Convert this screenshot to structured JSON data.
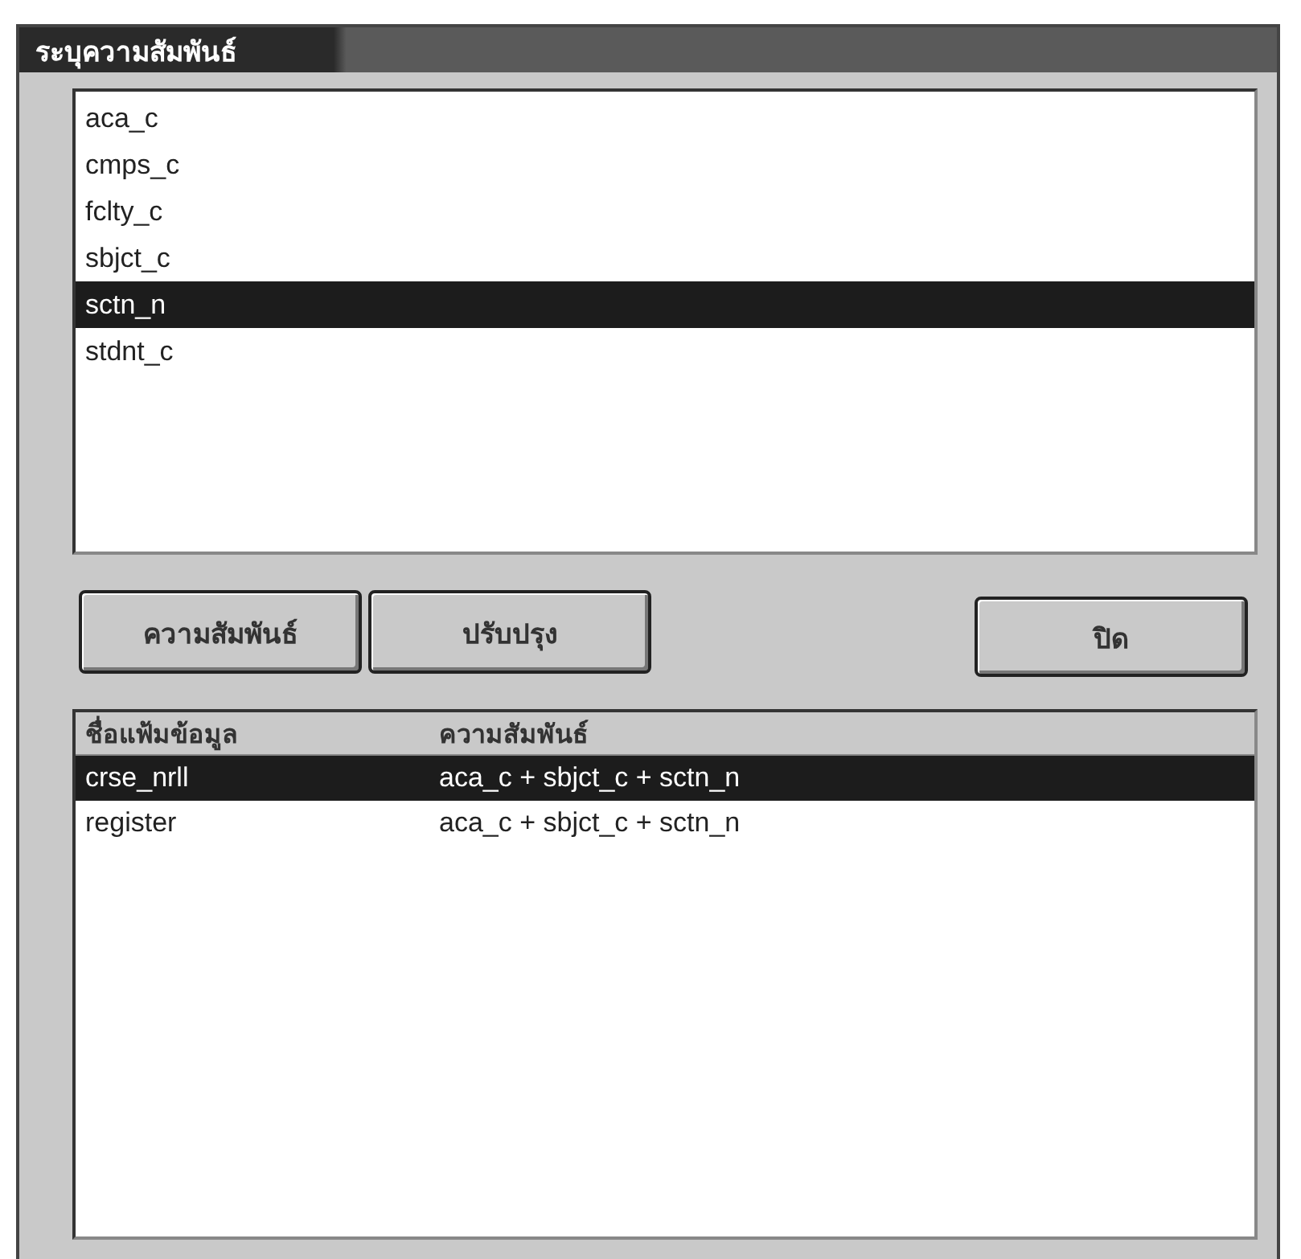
{
  "window": {
    "title": "ระบุความสัมพันธ์"
  },
  "field_list": {
    "items": [
      {
        "label": "aca_c",
        "selected": false
      },
      {
        "label": "cmps_c",
        "selected": false
      },
      {
        "label": "fclty_c",
        "selected": false
      },
      {
        "label": "sbjct_c",
        "selected": false
      },
      {
        "label": "sctn_n",
        "selected": true
      },
      {
        "label": "stdnt_c",
        "selected": false
      }
    ]
  },
  "buttons": [
    {
      "label": "ความสัมพันธ์",
      "kind": "left"
    },
    {
      "label": "ปรับปรุง",
      "kind": "left"
    },
    {
      "label": "ปิด",
      "kind": "right"
    }
  ],
  "table": {
    "columns": [
      "ชื่อแฟ้มข้อมูล",
      "ความสัมพันธ์"
    ],
    "rows": [
      {
        "cells": [
          "crse_nrll",
          "aca_c + sbjct_c + sctn_n"
        ],
        "selected": true
      },
      {
        "cells": [
          "register",
          "aca_c + sbjct_c + sctn_n"
        ],
        "selected": false
      }
    ]
  }
}
